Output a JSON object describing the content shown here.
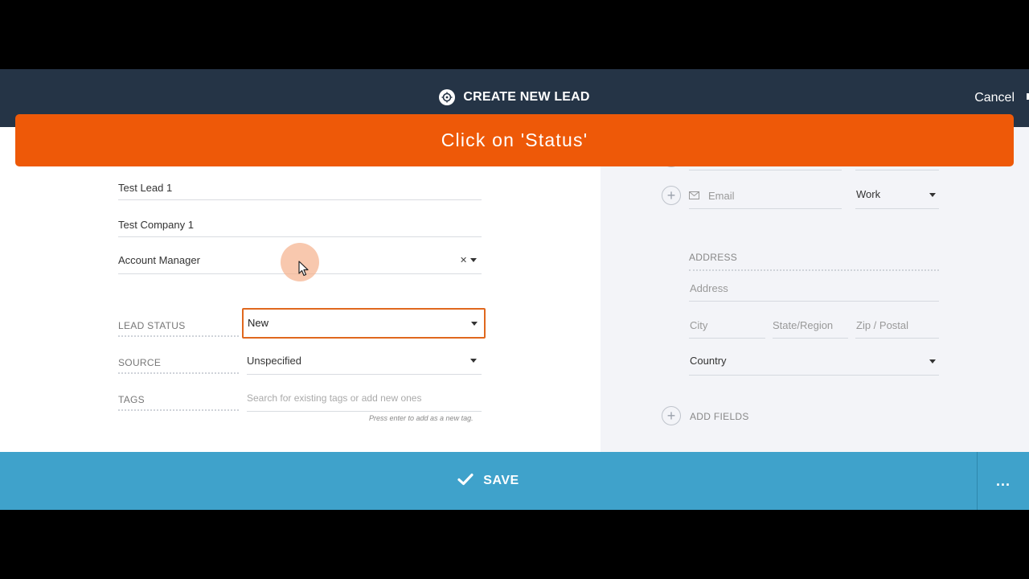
{
  "header": {
    "title": "CREATE NEW LEAD",
    "cancel_label": "Cancel",
    "title_icon": "target-icon"
  },
  "banner": {
    "text": "Click on 'Status'",
    "color": "#ee5908"
  },
  "form": {
    "lead_name": "Test Lead 1",
    "company": "Test Company 1",
    "owner": "Account Manager",
    "lead_status": {
      "label": "LEAD STATUS",
      "value": "New"
    },
    "source": {
      "label": "SOURCE",
      "value": "Unspecified"
    },
    "tags": {
      "label": "TAGS",
      "placeholder": "Search for existing tags or add new ones",
      "hint": "Press enter to add as a new tag."
    }
  },
  "contact": {
    "email_placeholder": "Email",
    "email_type": "Work"
  },
  "address": {
    "section_label": "ADDRESS",
    "address_placeholder": "Address",
    "city_placeholder": "City",
    "state_placeholder": "State/Region",
    "zip_placeholder": "Zip / Postal",
    "country_value": "Country"
  },
  "add_fields_label": "ADD FIELDS",
  "footer": {
    "save_label": "SAVE",
    "more_label": "..."
  },
  "colors": {
    "topbar": "#253446",
    "accent_orange": "#e0681e",
    "save_blue": "#3fa2cb",
    "right_panel_bg": "#f3f4f8"
  }
}
